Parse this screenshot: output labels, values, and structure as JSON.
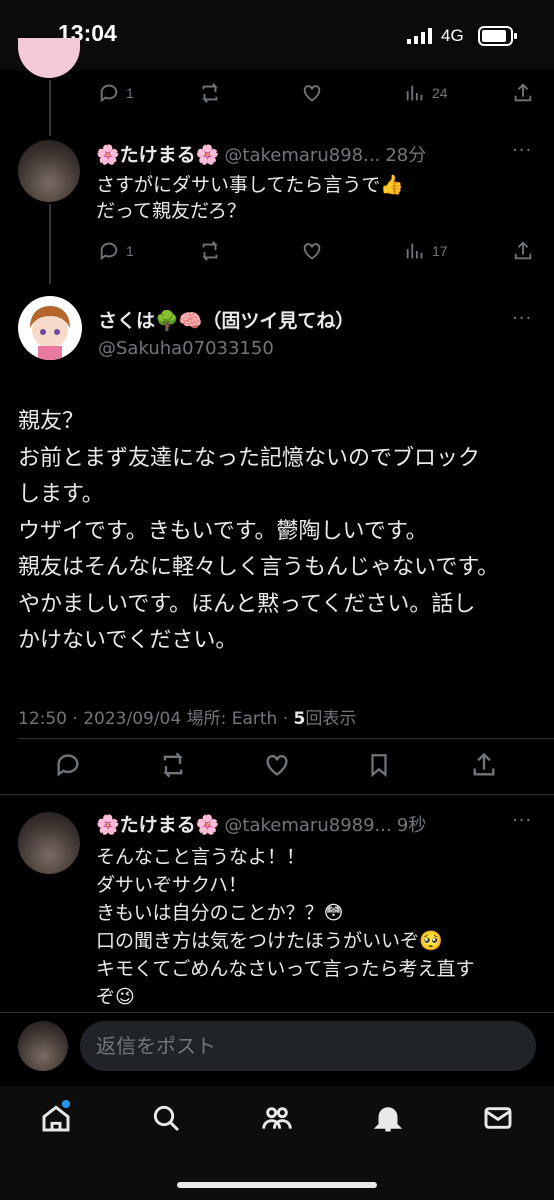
{
  "status_bar": {
    "time": "13:04",
    "network": "4G"
  },
  "prev_tweet_actions": {
    "replies": "1",
    "views": "24"
  },
  "reply1": {
    "name": "🌸たけまる🌸",
    "handle": "@takemaru898...",
    "time": "28分",
    "text": "さすがにダサい事してたら言うで👍\nだって親友だろ？",
    "replies": "1",
    "views": "17"
  },
  "main_tweet": {
    "name": "さくは🌳🧠（固ツイ見てね）",
    "handle": "@Sakuha07033150",
    "text": "親友？\nお前とまず友達になった記憶ないのでブロック\nします。\nウザイです。きもいです。鬱陶しいです。\n親友はそんなに軽々しく言うもんじゃないです。\nやかましいです。ほんと黙ってください。話し\nかけないでください。",
    "meta_prefix": "12:50 · 2023/09/04 場所: Earth · ",
    "views_count": "5",
    "views_label": "回表示"
  },
  "reply2": {
    "name": "🌸たけまる🌸",
    "handle": "@takemaru8989...",
    "time": "9秒",
    "text": "そんなこと言うなよ！！\nダサいぞサクハ！\nきもいは自分のことか？？😳\n口の聞き方は気をつけたほうがいいぞ🥺\nキモくてごめんなさいって言ったら考え直す\nぞ😉"
  },
  "reply_bar": {
    "placeholder": "返信をポスト"
  },
  "tab_bar": {
    "items": [
      "home-icon",
      "search-icon",
      "communities-icon",
      "notifications-icon",
      "messages-icon"
    ]
  }
}
